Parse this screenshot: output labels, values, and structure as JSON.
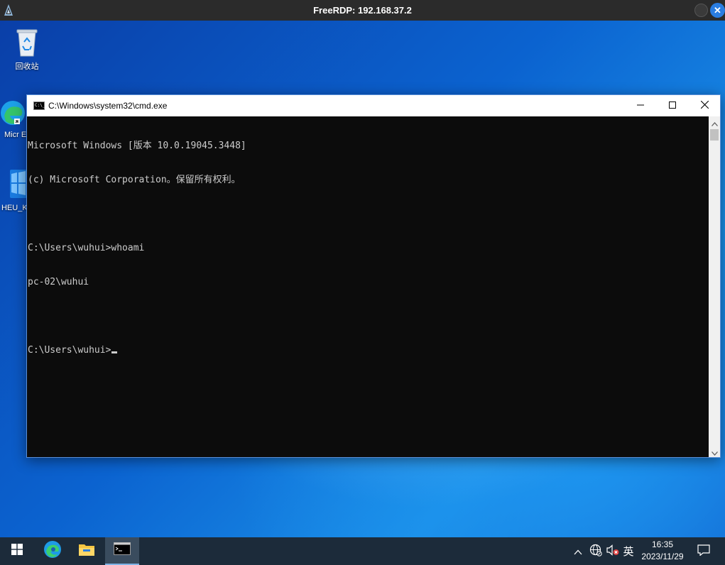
{
  "rdp": {
    "title": "FreeRDP: 192.168.37.2",
    "close_glyph": "✕"
  },
  "desktop": {
    "icons": [
      {
        "label": "回收站",
        "icon": "recycle-bin-icon"
      },
      {
        "label": "Micr Ed",
        "icon": "edge-icon"
      },
      {
        "label": "HEU_K",
        "icon": "heu-kms-icon"
      }
    ]
  },
  "cmd": {
    "title": "C:\\Windows\\system32\\cmd.exe",
    "icon_text": "C:\\_",
    "lines": [
      "Microsoft Windows [版本 10.0.19045.3448]",
      "(c) Microsoft Corporation。保留所有权利。",
      "",
      "C:\\Users\\wuhui>whoami",
      "pc-02\\wuhui",
      "",
      "C:\\Users\\wuhui>"
    ]
  },
  "taskbar": {
    "apps": [
      "start-icon",
      "edge-icon",
      "file-explorer-icon",
      "cmd-icon"
    ],
    "ime": "英",
    "time": "16:35",
    "date": "2023/11/29"
  },
  "colors": {
    "cmd_bg": "#0c0c0c",
    "cmd_fg": "#cccccc",
    "taskbar_bg": "#1c2b3a",
    "rdp_close": "#2a7de1"
  }
}
